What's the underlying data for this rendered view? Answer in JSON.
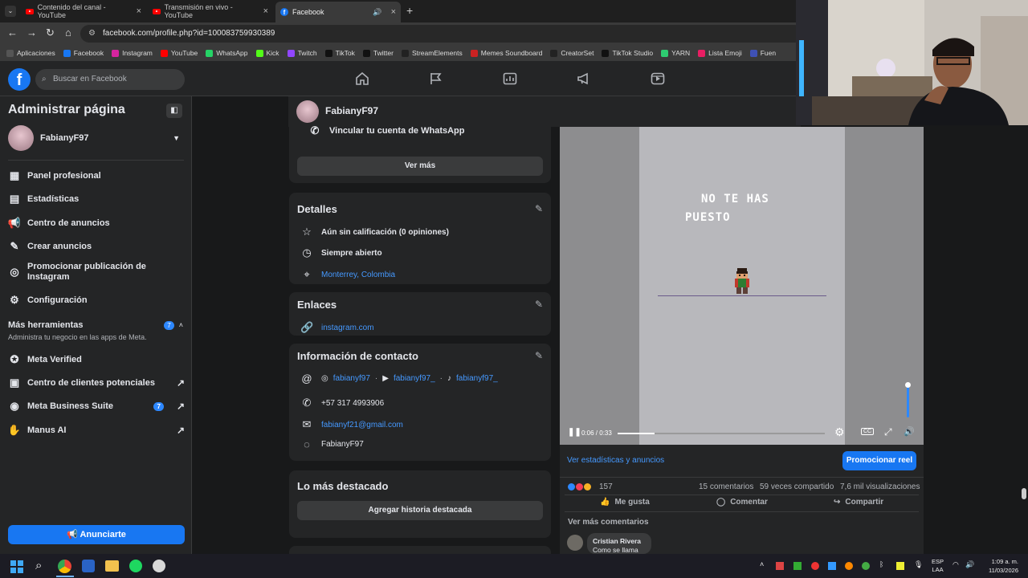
{
  "browser": {
    "tabs": [
      {
        "title": "Contenido del canal - YouTube",
        "icon": "youtube-icon"
      },
      {
        "title": "Transmisión en vivo - YouTube",
        "icon": "youtube-icon"
      },
      {
        "title": "Facebook",
        "icon": "facebook-icon",
        "active": true
      }
    ],
    "url": "facebook.com/profile.php?id=100083759930389",
    "bookmarks": [
      {
        "label": "Aplicaciones",
        "color": "#555555"
      },
      {
        "label": "Facebook",
        "color": "#1877f2"
      },
      {
        "label": "Instagram",
        "color": "#d6249f"
      },
      {
        "label": "YouTube",
        "color": "#ff0000"
      },
      {
        "label": "WhatsApp",
        "color": "#25d366"
      },
      {
        "label": "Kick",
        "color": "#53fc18"
      },
      {
        "label": "Twitch",
        "color": "#9146ff"
      },
      {
        "label": "TikTok",
        "color": "#111111"
      },
      {
        "label": "Twitter",
        "color": "#111111"
      },
      {
        "label": "StreamElements",
        "color": "#222222"
      },
      {
        "label": "Memes Soundboard",
        "color": "#cc2222"
      },
      {
        "label": "CreatorSet",
        "color": "#222222"
      },
      {
        "label": "TikTok Studio",
        "color": "#111111"
      },
      {
        "label": "YARN",
        "color": "#2ecc71"
      },
      {
        "label": "Lista Emoji",
        "color": "#e91e63"
      },
      {
        "label": "Fuen",
        "color": "#3f51b5"
      }
    ]
  },
  "fb": {
    "search_placeholder": "Buscar en Facebook"
  },
  "sidebar": {
    "title": "Administrar página",
    "profile_name": "FabianyF97",
    "items": [
      {
        "label": "Panel profesional"
      },
      {
        "label": "Estadísticas"
      },
      {
        "label": "Centro de anuncios"
      },
      {
        "label": "Crear anuncios"
      },
      {
        "label": "Promocionar publicación de Instagram"
      },
      {
        "label": "Configuración"
      }
    ],
    "tools_title": "Más herramientas",
    "tools_badge": "7",
    "tools_subtitle": "Administra tu negocio en las apps de Meta.",
    "tools": [
      {
        "label": "Meta Verified"
      },
      {
        "label": "Centro de clientes potenciales"
      },
      {
        "label": "Meta Business Suite",
        "badge": "7"
      },
      {
        "label": "Manus AI"
      }
    ],
    "cta": "Anunciarte"
  },
  "profile_header": {
    "name": "FabianyF97"
  },
  "intro": {
    "whatsapp": "Vincular tu cuenta de WhatsApp",
    "ver_mas": "Ver más"
  },
  "details": {
    "title": "Detalles",
    "rating": "Aún sin calificación (0 opiniones)",
    "hours": "Siempre abierto",
    "location": "Monterrey, Colombia"
  },
  "links": {
    "title": "Enlaces",
    "instagram": "instagram.com"
  },
  "contact": {
    "title": "Información de contacto",
    "ig": "fabianyf97",
    "yt": "fabianyf97_",
    "tt": "fabianyf97_",
    "sep": "·",
    "phone": "+57 317 4993906",
    "email": "fabianyf21@gmail.com",
    "messenger": "FabianyF97"
  },
  "highlights": {
    "title": "Lo más destacado",
    "button": "Agregar historia destacada"
  },
  "video": {
    "text_line1": "NO TE HAS",
    "text_line2": "PUESTO",
    "time": "0:06 / 0:33",
    "progress": 0.18,
    "volume": 1.0,
    "stats_link": "Ver estadísticas y anuncios",
    "promote": "Promocionar reel",
    "reactions_count": "157",
    "comments": "15 comentarios",
    "shares": "59 veces compartido",
    "views": "7,6 mil visualizaciones",
    "like": "Me gusta",
    "comment": "Comentar",
    "share": "Compartir",
    "more_comments": "Ver más comentarios",
    "commenter": "Cristian Rivera",
    "comment_text": "Como se llama"
  },
  "taskbar": {
    "lang1": "ESP",
    "lang2": "LAA",
    "time": "1:09 a. m.",
    "date": "11/03/2026"
  }
}
